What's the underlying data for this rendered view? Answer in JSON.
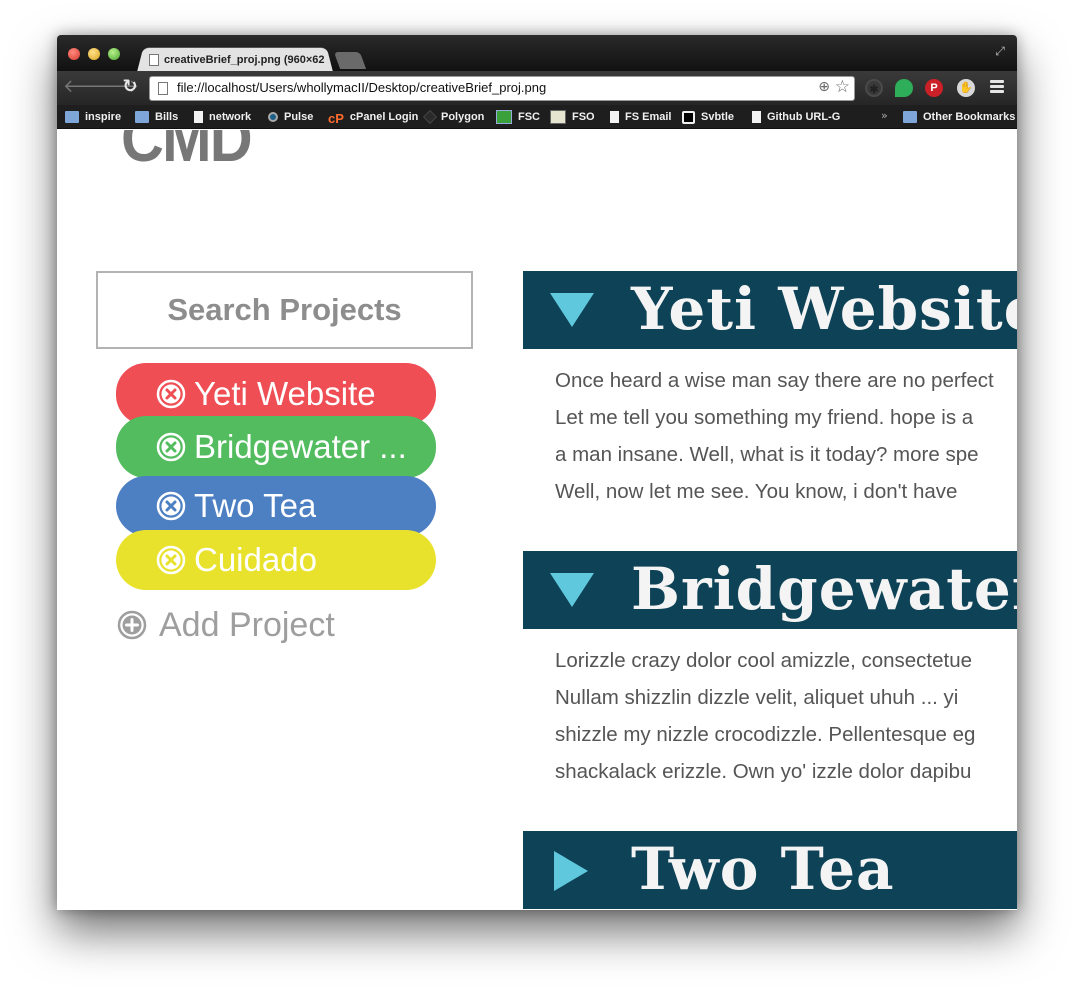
{
  "browser": {
    "tab_title": "creativeBrief_proj.png (960×62",
    "tab_close": "×",
    "url": "file://localhost/Users/whollymacII/Desktop/creativeBrief_proj.png",
    "bookmarks": [
      {
        "label": "inspire",
        "icon": "folder-icon"
      },
      {
        "label": "Bills",
        "icon": "folder-icon"
      },
      {
        "label": "network",
        "icon": "page-icon"
      },
      {
        "label": "Pulse",
        "icon": "pulse-icon"
      },
      {
        "label": "cPanel Login",
        "icon": "cpanel-icon"
      },
      {
        "label": "Polygon",
        "icon": "polygon-icon"
      },
      {
        "label": "FSC",
        "icon": "fsc-icon"
      },
      {
        "label": "FSO",
        "icon": "fso-icon"
      },
      {
        "label": "FS Email",
        "icon": "page-icon"
      },
      {
        "label": "Svbtle",
        "icon": "svbtle-icon"
      },
      {
        "label": "Github URL-G",
        "icon": "page-icon"
      }
    ],
    "bookmarks_overflow": "»",
    "other_bookmarks": "Other Bookmarks",
    "cpanel_glyph": "cP"
  },
  "page": {
    "logo": "CMD",
    "search": {
      "label": "Search Projects"
    },
    "projects": [
      {
        "label": "Yeti Website",
        "color": "#ef4e54"
      },
      {
        "label": "Bridgewater ...",
        "color": "#52bc5f"
      },
      {
        "label": "Two Tea",
        "color": "#4d7fc3"
      },
      {
        "label": "Cuidado",
        "color": "#e9e22c"
      }
    ],
    "add_project": "Add Project",
    "sections": [
      {
        "title": "Yeti Website",
        "expanded": true,
        "lines": [
          "Once heard a wise man say there are no perfect",
          "Let me tell you something my friend. hope is a",
          "a man insane. Well, what is it today? more spe",
          "Well, now let me see. You know, i don't have"
        ]
      },
      {
        "title": "Bridgewater",
        "expanded": true,
        "lines": [
          "Lorizzle crazy dolor cool amizzle, consectetue",
          " Nullam shizzlin dizzle velit, aliquet uhuh ... yi",
          "shizzle my nizzle crocodizzle. Pellentesque eg",
          "shackalack erizzle. Own yo' izzle dolor dapibu"
        ]
      },
      {
        "title": "Two Tea",
        "expanded": false,
        "lines": []
      }
    ],
    "colors": {
      "banner": "#0d4257",
      "triangle": "#5fc8dc",
      "banner_text": "#f4f4f4"
    }
  }
}
